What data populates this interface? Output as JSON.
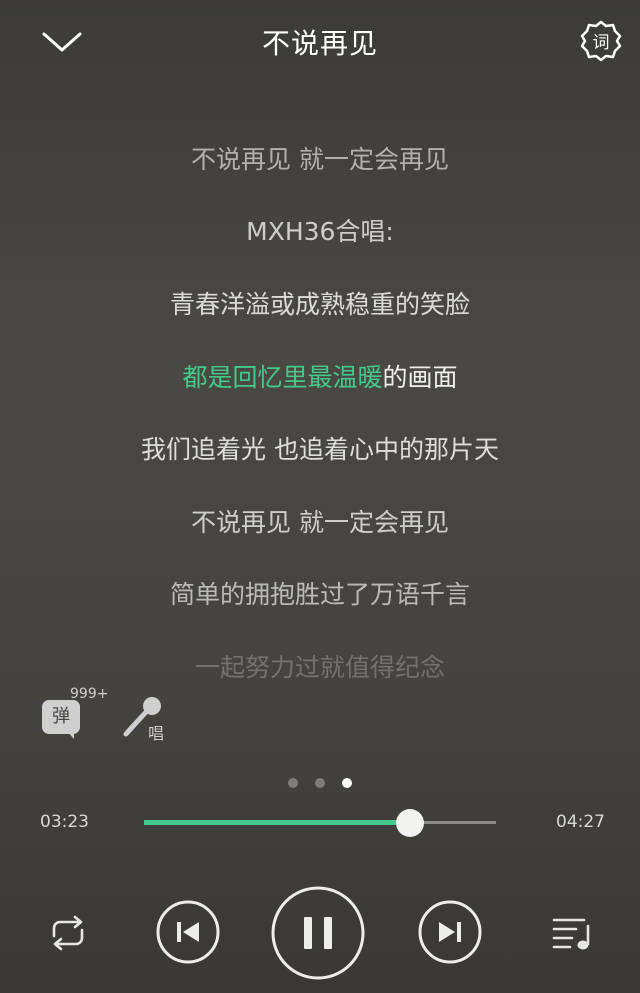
{
  "header": {
    "title": "不说再见",
    "lyric_settings_label": "词"
  },
  "lyrics": {
    "lines": [
      "不说再见 就一定会再见",
      "MXH36合唱:",
      "青春洋溢或成熟稳重的笑脸",
      "",
      "我们追着光 也追着心中的那片天",
      "不说再见 就一定会再见",
      "简单的拥抱胜过了万语千言",
      "一起努力过就值得纪念"
    ],
    "top_cut_line": "",
    "current_line": {
      "sung": "都是回忆里最温暖",
      "remaining": "的画面"
    }
  },
  "actions": {
    "danmu_label": "弹",
    "danmu_count": "999+",
    "sing_label": "唱"
  },
  "pager": {
    "pages": 3,
    "active_index": 2
  },
  "player": {
    "current_time": "03:23",
    "total_time": "04:27",
    "progress_fraction": 0.7566
  },
  "colors": {
    "accent": "#43c98a",
    "text": "#ffffff",
    "background": "#45433e"
  },
  "icons": {
    "back": "chevron-down-icon",
    "lyric_settings": "gear-icon",
    "danmu": "comment-bubble-icon",
    "sing": "microphone-icon",
    "repeat": "repeat-icon",
    "prev": "skip-previous-icon",
    "play": "pause-icon",
    "next": "skip-next-icon",
    "playlist": "playlist-icon"
  }
}
